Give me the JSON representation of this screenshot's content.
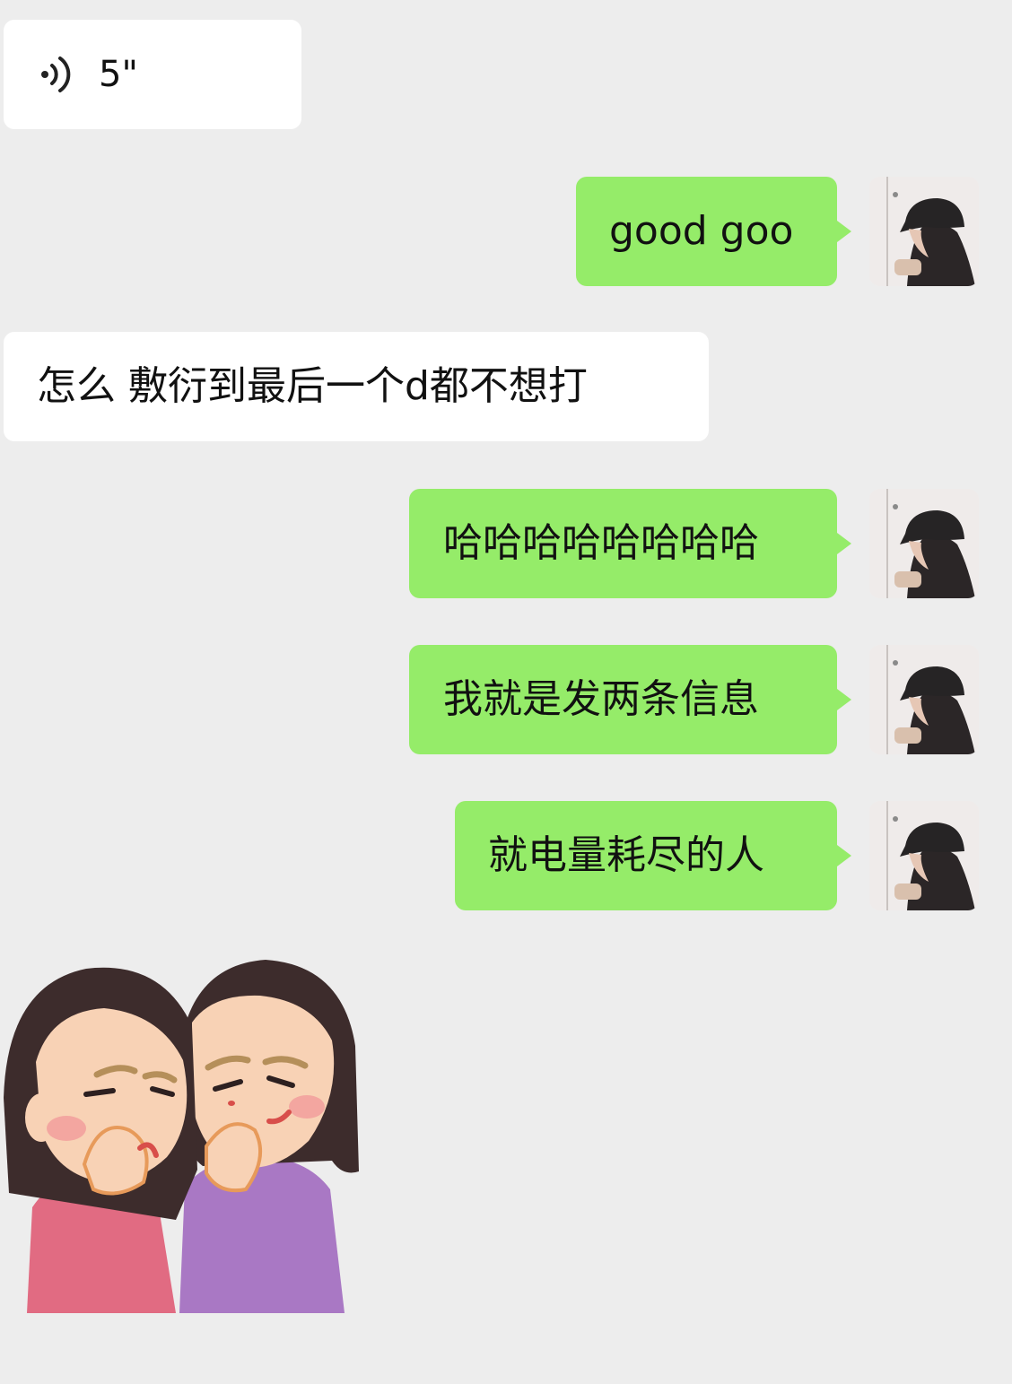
{
  "messages": {
    "voice": {
      "duration": "5\"",
      "icon": "voice-wave-icon"
    },
    "good_goo": "good goo",
    "zenme": "怎么 敷衍到最后一个d都不想打",
    "haha": "哈哈哈哈哈哈哈哈",
    "liangtiao": "我就是发两条信息",
    "dianliang": "就电量耗尽的人",
    "sticker": {
      "icon": "whispering-girls-sticker"
    }
  },
  "colors": {
    "background": "#ededed",
    "incoming_bubble": "#ffffff",
    "outgoing_bubble": "#95ec69"
  }
}
